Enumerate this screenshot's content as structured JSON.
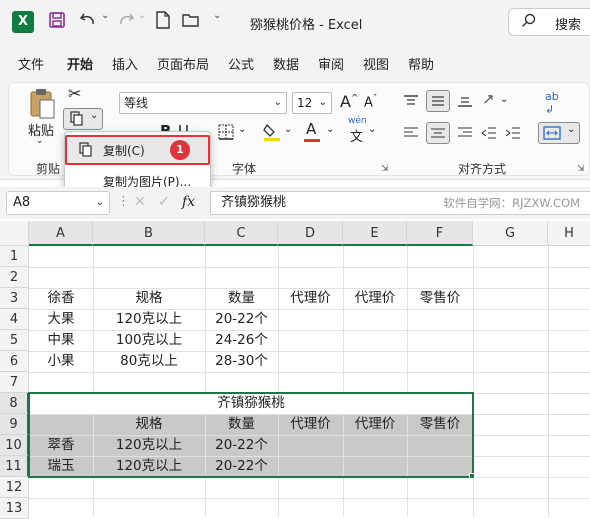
{
  "titlebar": {
    "doc_title": "猕猴桃价格  -  Excel",
    "search_label": "搜索"
  },
  "menu": {
    "items": [
      "文件",
      "开始",
      "插入",
      "页面布局",
      "公式",
      "数据",
      "审阅",
      "视图",
      "帮助"
    ],
    "active": "开始"
  },
  "ribbon": {
    "paste_label": "粘贴",
    "clipboard_label": "剪贴",
    "font_name": "等线",
    "font_size": "12",
    "font_group_label": "字体",
    "align_group_label": "对齐方式",
    "bold": "B",
    "italic": "I",
    "underline": "U",
    "font_color_letter": "A",
    "wen_label": "wén",
    "wen_char": "文",
    "grow_font": "A",
    "shrink_font": "A"
  },
  "popup": {
    "copy_label": "复制(C)",
    "copy_picture_label": "复制为图片(P)...",
    "badge": "1"
  },
  "formula_bar": {
    "name_box": "A8",
    "fx": "fx",
    "formula": "齐镇猕猴桃",
    "watermark": "软件自学网：RJZXW.COM"
  },
  "grid": {
    "columns": [
      "A",
      "B",
      "C",
      "D",
      "E",
      "F",
      "G",
      "H"
    ],
    "rows": [
      "1",
      "2",
      "3",
      "4",
      "5",
      "6",
      "7",
      "8",
      "9",
      "10",
      "11",
      "12",
      "13"
    ],
    "cells": {
      "r3": [
        "徐香",
        "规格",
        "数量",
        "代理价",
        "代理价",
        "零售价"
      ],
      "r4": [
        "大果",
        "120克以上",
        "20-22个"
      ],
      "r5": [
        "中果",
        "100克以上",
        "24-26个"
      ],
      "r6": [
        "小果",
        "80克以上",
        "28-30个"
      ],
      "r8": "齐镇猕猴桃",
      "r9": [
        "",
        "规格",
        "数量",
        "代理价",
        "代理价",
        "零售价"
      ],
      "r10": [
        "翠香",
        "120克以上",
        "20-22个"
      ],
      "r11": [
        "瑞玉",
        "120克以上",
        "20-22个"
      ]
    }
  },
  "colors": {
    "excel_green": "#107c41",
    "highlight_red": "#e0343a",
    "selection_gray": "#c8c8c8",
    "selection_border": "#217346"
  }
}
